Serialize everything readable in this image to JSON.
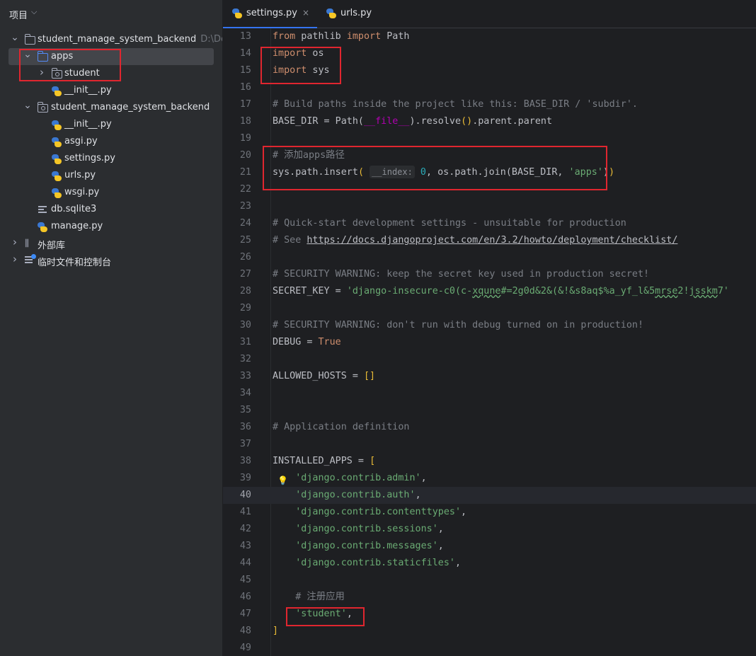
{
  "sidebar": {
    "title": "项目",
    "tree": [
      {
        "name": "tree-root",
        "arrow": "expanded",
        "icon": "folder",
        "label": "student_manage_system_backend",
        "hint": "D:\\Dev"
      },
      {
        "name": "tree-apps",
        "arrow": "expanded",
        "icon": "folder-blue",
        "label": "apps"
      },
      {
        "name": "tree-student",
        "arrow": "collapsed",
        "icon": "folder-package",
        "label": "student"
      },
      {
        "name": "tree-apps-init",
        "icon": "python",
        "label": "__init__.py"
      },
      {
        "name": "tree-pkg",
        "arrow": "expanded",
        "icon": "folder-package",
        "label": "student_manage_system_backend"
      },
      {
        "name": "tree-pkg-init",
        "icon": "python",
        "label": "__init__.py"
      },
      {
        "name": "tree-asgi",
        "icon": "python",
        "label": "asgi.py"
      },
      {
        "name": "tree-settings",
        "icon": "python",
        "label": "settings.py"
      },
      {
        "name": "tree-urls",
        "icon": "python",
        "label": "urls.py"
      },
      {
        "name": "tree-wsgi",
        "icon": "python",
        "label": "wsgi.py"
      },
      {
        "name": "tree-db",
        "icon": "lines",
        "label": "db.sqlite3"
      },
      {
        "name": "tree-manage",
        "icon": "python",
        "label": "manage.py"
      },
      {
        "name": "tree-external-libs",
        "arrow": "collapsed",
        "icon": "library",
        "label": "外部库"
      },
      {
        "name": "tree-scratches",
        "arrow": "collapsed",
        "icon": "scratch",
        "label": "临时文件和控制台"
      }
    ]
  },
  "tabs": [
    {
      "label": "settings.py",
      "close": "×",
      "active": true
    },
    {
      "label": "urls.py",
      "active": false
    }
  ],
  "editor": {
    "current_line": 40,
    "lines": [
      {
        "n": 13,
        "code": "<span class=\"kw\">from</span> pathlib <span class=\"kw\">import</span> Path"
      },
      {
        "n": 14,
        "code": "<span class=\"kw\">import</span> os"
      },
      {
        "n": 15,
        "code": "<span class=\"kw\">import</span> sys"
      },
      {
        "n": 16,
        "code": ""
      },
      {
        "n": 17,
        "code": "<span class=\"cm\"># Build paths inside the project like this: BASE_DIR / 'subdir'.</span>"
      },
      {
        "n": 18,
        "code": "BASE_DIR = Path(<span class=\"dunder\">__file__</span>).resolve<span class=\"br\">()</span>.parent.parent"
      },
      {
        "n": 19,
        "code": ""
      },
      {
        "n": 20,
        "code": "<span class=\"cm\"># 添加apps路径</span>"
      },
      {
        "n": 21,
        "code": "sys.path.insert<span class=\"br\">(</span> <span class=\"hintbox\">__index:</span> <span class=\"num\">0</span>, os.path.join(BASE_DIR, <span class=\"str\">'apps'</span>)<span class=\"br\">)</span>"
      },
      {
        "n": 22,
        "code": ""
      },
      {
        "n": 23,
        "code": ""
      },
      {
        "n": 24,
        "code": "<span class=\"cm\"># Quick-start development settings - unsuitable for production</span>"
      },
      {
        "n": 25,
        "code": "<span class=\"cm\"># See </span><span class=\"lnk\">https://docs.djangoproject.com/en/3.2/howto/deployment/checklist/</span>"
      },
      {
        "n": 26,
        "code": ""
      },
      {
        "n": 27,
        "code": "<span class=\"cm\"># SECURITY WARNING: keep the secret key used in production secret!</span>"
      },
      {
        "n": 28,
        "code": "SECRET_KEY = <span class=\"str\">'django-insecure-c0(c-<span class=\"warn\">xqune</span>#=2g0d&amp;2&amp;(&amp;!&amp;s8aq$%a_yf_l&amp;5<span class=\"warn\">mrse</span>2!<span class=\"warn\">jsskm</span>7'</span>"
      },
      {
        "n": 29,
        "code": ""
      },
      {
        "n": 30,
        "code": "<span class=\"cm\"># SECURITY WARNING: don't run with debug turned on in production!</span>"
      },
      {
        "n": 31,
        "code": "DEBUG = <span class=\"kw\">True</span>"
      },
      {
        "n": 32,
        "code": ""
      },
      {
        "n": 33,
        "code": "ALLOWED_HOSTS = <span class=\"br\">[]</span>"
      },
      {
        "n": 34,
        "code": ""
      },
      {
        "n": 35,
        "code": ""
      },
      {
        "n": 36,
        "code": "<span class=\"cm\"># Application definition</span>"
      },
      {
        "n": 37,
        "code": ""
      },
      {
        "n": 38,
        "code": "INSTALLED_APPS = <span class=\"br\">[</span>"
      },
      {
        "n": 39,
        "code": "    <span class=\"str\">'django.contrib.admin'</span>,",
        "bulb": true
      },
      {
        "n": 40,
        "code": "    <span class=\"str\">'django.contrib.auth'</span>,"
      },
      {
        "n": 41,
        "code": "    <span class=\"str\">'django.contrib.contenttypes'</span>,"
      },
      {
        "n": 42,
        "code": "    <span class=\"str\">'django.contrib.sessions'</span>,"
      },
      {
        "n": 43,
        "code": "    <span class=\"str\">'django.contrib.messages'</span>,"
      },
      {
        "n": 44,
        "code": "    <span class=\"str\">'django.contrib.staticfiles'</span>,"
      },
      {
        "n": 45,
        "code": ""
      },
      {
        "n": 46,
        "code": "    <span class=\"cm\"># 注册应用</span>"
      },
      {
        "n": 47,
        "code": "    <span class=\"str\">'student'</span>,"
      },
      {
        "n": 48,
        "code": "<span class=\"br\">]</span>"
      },
      {
        "n": 49,
        "code": ""
      }
    ]
  },
  "icons": {
    "sidebar_chevron": "chevron-down-icon",
    "tab_icon": "python-file-icon",
    "bulb": "lightbulb-icon"
  },
  "colors": {
    "annotation_box": "#e0262f",
    "accent": "#3574f0"
  }
}
